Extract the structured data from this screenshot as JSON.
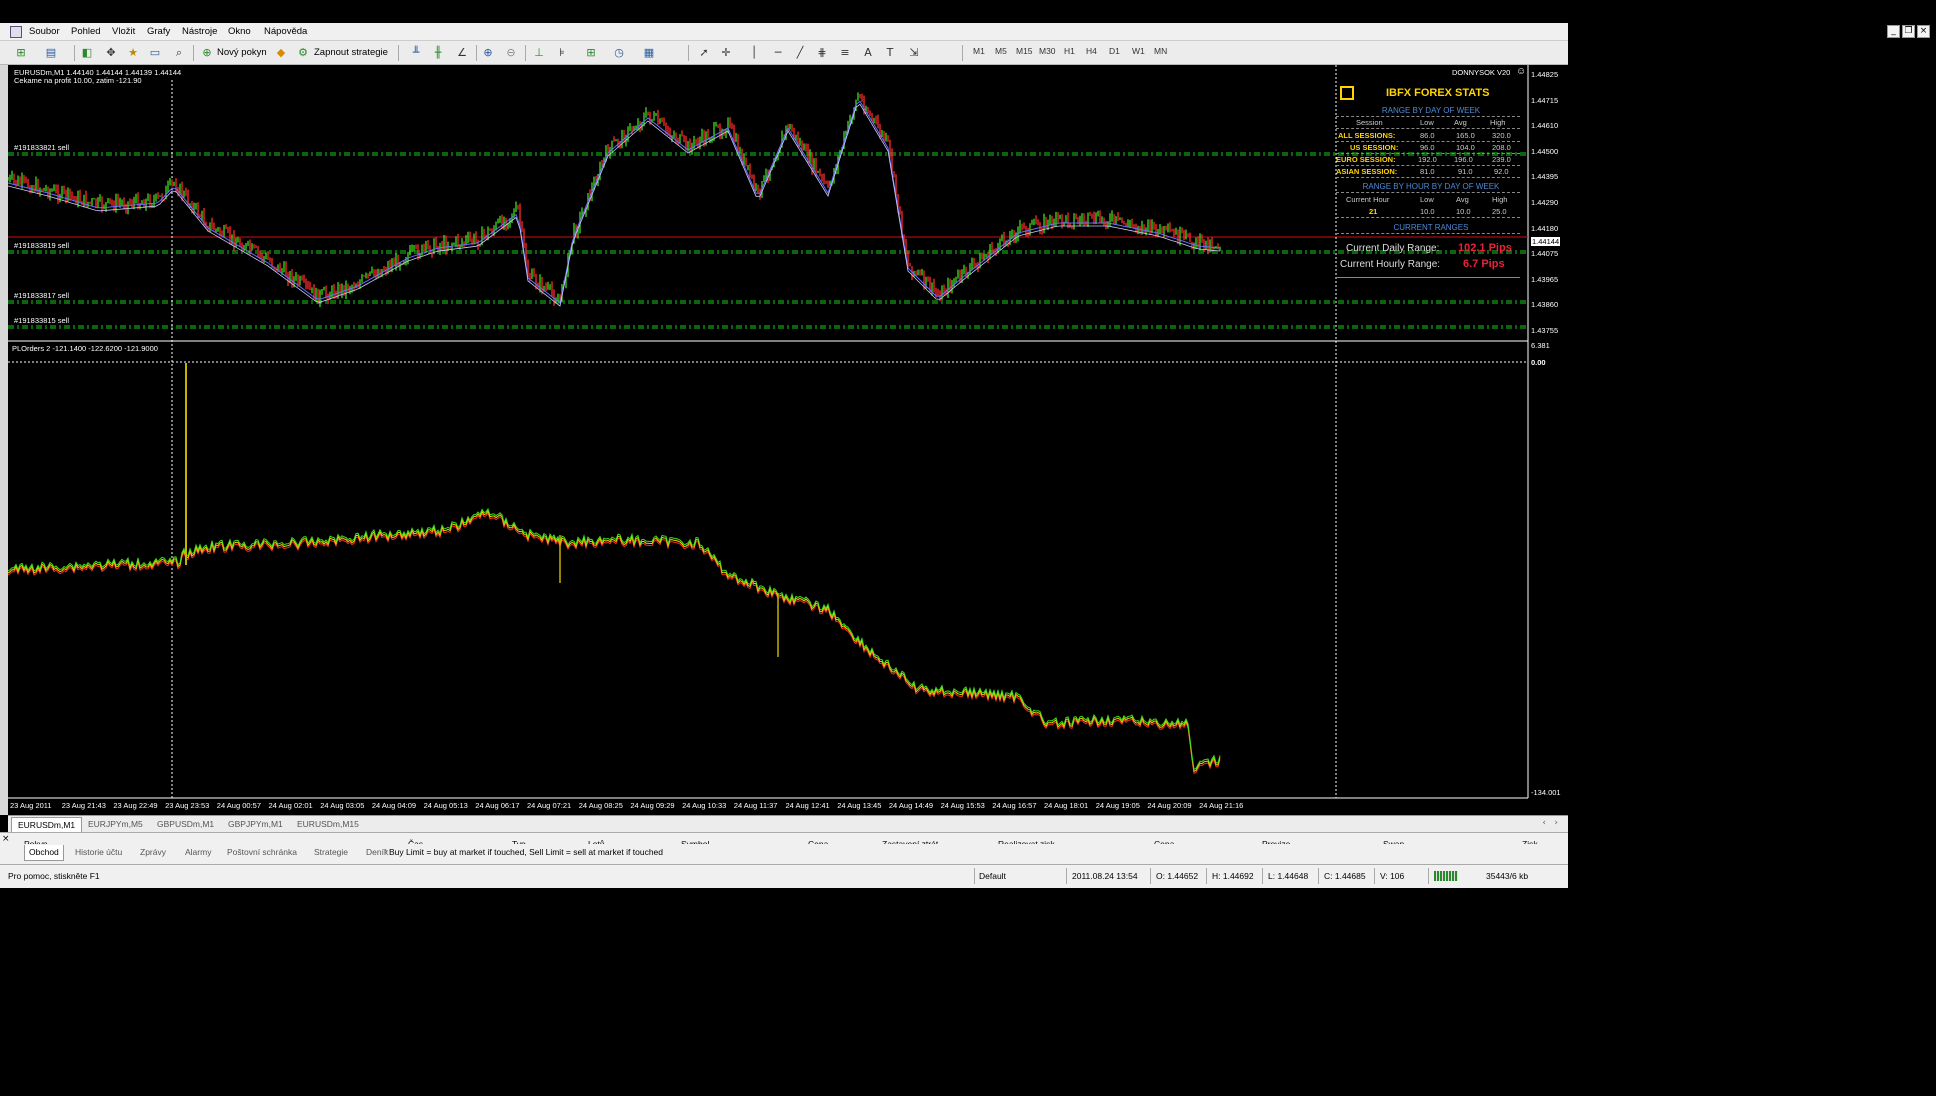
{
  "menu": {
    "items": [
      "Soubor",
      "Pohled",
      "Vložit",
      "Grafy",
      "Nástroje",
      "Okno",
      "Nápověda"
    ]
  },
  "toolbar": {
    "new_order": "Nový pokyn",
    "strategy": "Zapnout strategie",
    "timeframes": [
      "M1",
      "M5",
      "M15",
      "M30",
      "H1",
      "H4",
      "D1",
      "W1",
      "MN"
    ]
  },
  "chart": {
    "header": "EURUSDm,M1  1.44140 1.44144 1.44139 1.44144",
    "subheader": "Cekame na profit 10.00, zatim -121.90",
    "signature": "DONNYSOK V20",
    "orders": [
      "#191833821 sell",
      "#191833819 sell",
      "#191833817 sell",
      "#191833815 sell"
    ],
    "price_axis": [
      "1.44825",
      "1.44715",
      "1.44610",
      "1.44500",
      "1.44395",
      "1.44290",
      "1.44180",
      "1.44075",
      "1.43965",
      "1.43860",
      "1.43755"
    ],
    "current_price": "1.44144",
    "indicator_header": "PLOrders 2 -121.1400 -122.6200 -121.9000",
    "indicator_axis": [
      "6.381",
      "0.00",
      "-134.001"
    ],
    "time_axis": [
      "23 Aug 2011",
      "23 Aug 21:43",
      "23 Aug 22:49",
      "23 Aug 23:53",
      "24 Aug 00:57",
      "24 Aug 02:01",
      "24 Aug 03:05",
      "24 Aug 04:09",
      "24 Aug 05:13",
      "24 Aug 06:17",
      "24 Aug 07:21",
      "24 Aug 08:25",
      "24 Aug 09:29",
      "24 Aug 10:33",
      "24 Aug 11:37",
      "24 Aug 12:41",
      "24 Aug 13:45",
      "24 Aug 14:49",
      "24 Aug 15:53",
      "24 Aug 16:57",
      "24 Aug 18:01",
      "24 Aug 19:05",
      "24 Aug 20:09",
      "24 Aug 21:16"
    ]
  },
  "stats": {
    "title": "IBFX FOREX STATS",
    "range_day": "RANGE BY DAY OF WEEK",
    "cols": [
      "Session",
      "Low",
      "Avg",
      "High"
    ],
    "rows": [
      {
        "name": "ALL SESSIONS:",
        "low": "86.0",
        "avg": "165.0",
        "high": "320.0"
      },
      {
        "name": "US SESSION:",
        "low": "96.0",
        "avg": "104.0",
        "high": "208.0"
      },
      {
        "name": "EURO SESSION:",
        "low": "192.0",
        "avg": "196.0",
        "high": "239.0"
      },
      {
        "name": "ASIAN SESSION:",
        "low": "81.0",
        "avg": "91.0",
        "high": "92.0"
      }
    ],
    "range_hour": "RANGE BY HOUR BY DAY OF WEEK",
    "hour_cols": [
      "Current Hour",
      "Low",
      "Avg",
      "High"
    ],
    "hour_row": {
      "hour": "21",
      "low": "10.0",
      "avg": "10.0",
      "high": "25.0"
    },
    "current_ranges": "CURRENT RANGES",
    "daily_label": "Current Daily Range:",
    "daily_value": "102.1 Pips",
    "hourly_label": "Current Hourly Range:",
    "hourly_value": "6.7 Pips",
    "colors": {
      "title": "#ffd400",
      "sub": "#4d8ad8",
      "value": "#e8223a",
      "session": "#ffd400"
    }
  },
  "chart_tabs": [
    "EURUSDm,M1",
    "EURJPYm,M5",
    "GBPUSDm,M1",
    "GBPJPYm,M1",
    "EURUSDm,M15"
  ],
  "terminal": {
    "columns": [
      "Pokyn",
      "Čas",
      "Typ",
      "Lotů",
      "Symbol",
      "Cena",
      "Zastavení ztrát",
      "Realizovat zisk",
      "Cena",
      "Provize",
      "Swap",
      "Zisk"
    ],
    "tabs": [
      "Obchod",
      "Historie účtu",
      "Zprávy",
      "Alarmy",
      "Poštovní schránka",
      "Strategie",
      "Deník"
    ],
    "journal_text": "Buy Limit = buy at market if touched, Sell Limit = sell at market if touched"
  },
  "status": {
    "help": "Pro pomoc, stiskněte F1",
    "profile": "Default",
    "datetime": "2011.08.24 13:54",
    "open": "O: 1.44652",
    "high": "H: 1.44692",
    "low": "L: 1.44648",
    "close": "C: 1.44685",
    "volume": "V: 106",
    "traffic": "35443/6 kb"
  }
}
